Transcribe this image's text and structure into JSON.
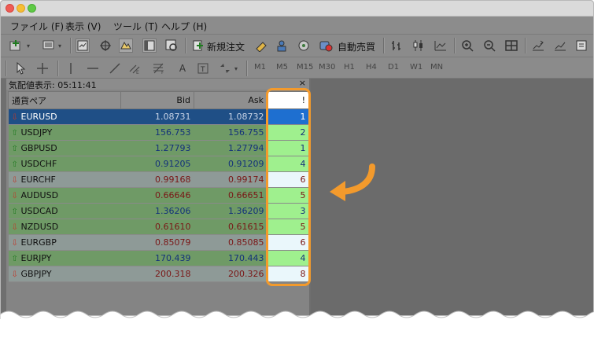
{
  "menu": {
    "items": [
      "ファイル (F)",
      "表示 (V)",
      "ツール (T)",
      "ヘルプ (H)"
    ]
  },
  "toolbar": {
    "new_order_label": "新規注文",
    "auto_trade_label": "自動売買",
    "timeframes": [
      "M1",
      "M5",
      "M15",
      "M30",
      "H1",
      "H4",
      "D1",
      "W1",
      "MN"
    ]
  },
  "market_watch": {
    "title": "気配値表示: 05:11:41",
    "close_label": "×",
    "columns": {
      "symbol": "通貨ペア",
      "bid": "Bid",
      "ask": "Ask",
      "spread": "!"
    },
    "rows": [
      {
        "symbol": "EURUSD",
        "bid": "1.08731",
        "ask": "1.08732",
        "spread": "1",
        "direction": "down",
        "selected": true
      },
      {
        "symbol": "USDJPY",
        "bid": "156.753",
        "ask": "156.755",
        "spread": "2",
        "direction": "up"
      },
      {
        "symbol": "GBPUSD",
        "bid": "1.27793",
        "ask": "1.27794",
        "spread": "1",
        "direction": "up"
      },
      {
        "symbol": "USDCHF",
        "bid": "0.91205",
        "ask": "0.91209",
        "spread": "4",
        "direction": "up"
      },
      {
        "symbol": "EURCHF",
        "bid": "0.99168",
        "ask": "0.99174",
        "spread": "6",
        "direction": "down"
      },
      {
        "symbol": "AUDUSD",
        "bid": "0.66646",
        "ask": "0.66651",
        "spread": "5",
        "direction": "down"
      },
      {
        "symbol": "USDCAD",
        "bid": "1.36206",
        "ask": "1.36209",
        "spread": "3",
        "direction": "up"
      },
      {
        "symbol": "NZDUSD",
        "bid": "0.61610",
        "ask": "0.61615",
        "spread": "5",
        "direction": "down"
      },
      {
        "symbol": "EURGBP",
        "bid": "0.85079",
        "ask": "0.85085",
        "spread": "6",
        "direction": "down"
      },
      {
        "symbol": "EURJPY",
        "bid": "170.439",
        "ask": "170.443",
        "spread": "4",
        "direction": "up"
      },
      {
        "symbol": "GBPJPY",
        "bid": "200.318",
        "ask": "200.326",
        "spread": "8",
        "direction": "down"
      }
    ]
  },
  "colors": {
    "highlight": "#f39a2c",
    "up_text": "#13317a",
    "down_text": "#7a1616"
  }
}
